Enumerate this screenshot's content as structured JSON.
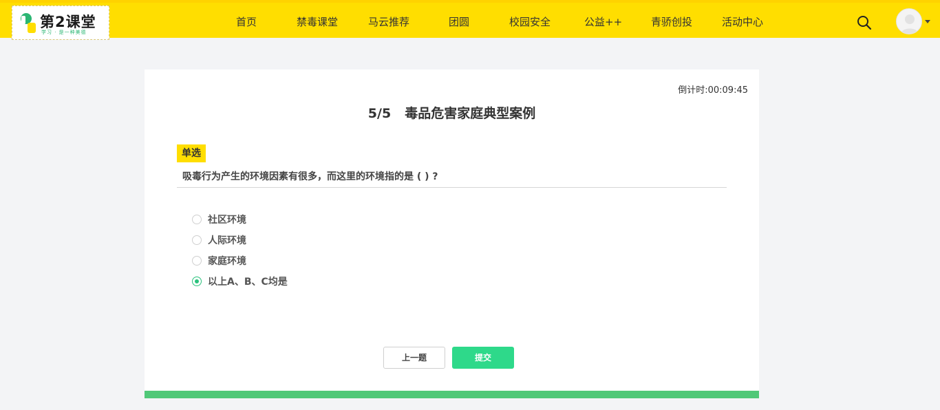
{
  "header": {
    "logo_text": "第2课堂",
    "logo_sub": "学习 · 是一种美德",
    "nav": [
      {
        "label": "首页"
      },
      {
        "label": "禁毒课堂"
      },
      {
        "label": "马云推荐"
      },
      {
        "label": "团圆"
      },
      {
        "label": "校园安全"
      },
      {
        "label": "公益++"
      },
      {
        "label": "青骄创投"
      },
      {
        "label": "活动中心"
      }
    ],
    "search_icon": "search-icon",
    "avatar_icon": "user-avatar"
  },
  "quiz": {
    "countdown_label": "倒计时:",
    "countdown_value": "00:09:45",
    "progress": "5/5",
    "title": "毒品危害家庭典型案例",
    "question_type": "单选",
    "question": "吸毒行为产生的环境因素有很多，而这里的环境指的是 ( ) ?",
    "options": [
      {
        "label": "社区环境",
        "checked": false
      },
      {
        "label": "人际环境",
        "checked": false
      },
      {
        "label": "家庭环境",
        "checked": false
      },
      {
        "label": "以上A、B、C均是",
        "checked": true
      }
    ],
    "prev_label": "上一题",
    "submit_label": "提交"
  },
  "colors": {
    "topbar": "#ffde00",
    "accent_green": "#2ed98a",
    "progress_bar": "#50c878"
  }
}
